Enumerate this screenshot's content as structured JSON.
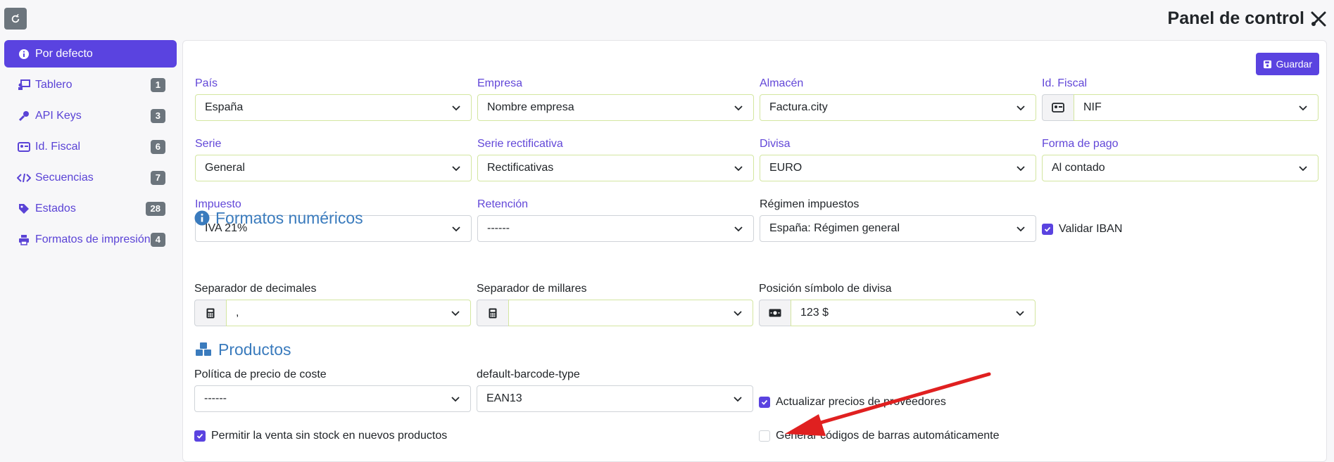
{
  "header": {
    "title": "Panel de control",
    "title_icon": "tools-icon",
    "refresh_icon": "refresh-icon"
  },
  "sidebar": {
    "items": [
      {
        "label": "Por defecto",
        "icon": "info-icon",
        "badge": null,
        "active": true
      },
      {
        "label": "Tablero",
        "icon": "chalkboard-icon",
        "badge": "1"
      },
      {
        "label": "API Keys",
        "icon": "key-icon",
        "badge": "3"
      },
      {
        "label": "Id. Fiscal",
        "icon": "id-card-icon",
        "badge": "6"
      },
      {
        "label": "Secuencias",
        "icon": "code-icon",
        "badge": "7"
      },
      {
        "label": "Estados",
        "icon": "tags-icon",
        "badge": "28"
      },
      {
        "label": "Formatos de impresión",
        "icon": "print-icon",
        "badge": "4"
      }
    ]
  },
  "toolbar": {
    "save_label": "Guardar",
    "save_icon": "save-icon"
  },
  "fields": {
    "pais": {
      "label": "País",
      "value": "España"
    },
    "empresa": {
      "label": "Empresa",
      "value": "Nombre empresa"
    },
    "almacen": {
      "label": "Almacén",
      "value": "Factura.city"
    },
    "id_fiscal": {
      "label": "Id. Fiscal",
      "value": "NIF"
    },
    "serie": {
      "label": "Serie",
      "value": "General"
    },
    "serie_rect": {
      "label": "Serie rectificativa",
      "value": "Rectificativas"
    },
    "divisa": {
      "label": "Divisa",
      "value": "EURO"
    },
    "forma_pago": {
      "label": "Forma de pago",
      "value": "Al contado"
    },
    "impuesto": {
      "label": "Impuesto",
      "value": "IVA 21%"
    },
    "retencion": {
      "label": "Retención",
      "value": "------"
    },
    "regimen": {
      "label": "Régimen impuestos",
      "value": "España: Régimen general"
    },
    "validar_iban": {
      "label": "Validar IBAN",
      "checked": true
    }
  },
  "numeric": {
    "title": "Formatos numéricos",
    "sep_decimales": {
      "label": "Separador de decimales",
      "value": ","
    },
    "sep_millares": {
      "label": "Separador de millares",
      "value": ""
    },
    "pos_divisa": {
      "label": "Posición símbolo de divisa",
      "value": "123 $"
    }
  },
  "products": {
    "title": "Productos",
    "politica": {
      "label": "Política de precio de coste",
      "value": "------"
    },
    "barcode": {
      "label": "default-barcode-type",
      "value": "EAN13"
    },
    "actualizar": {
      "label": "Actualizar precios de proveedores",
      "checked": true
    },
    "permitir": {
      "label": "Permitir la venta sin stock en nuevos productos",
      "checked": true
    },
    "generar": {
      "label": "Generar códigos de barras automáticamente",
      "checked": false
    }
  },
  "colors": {
    "accent": "#5a43e0",
    "section": "#3a7bbd",
    "annotation_arrow": "#e02020"
  }
}
